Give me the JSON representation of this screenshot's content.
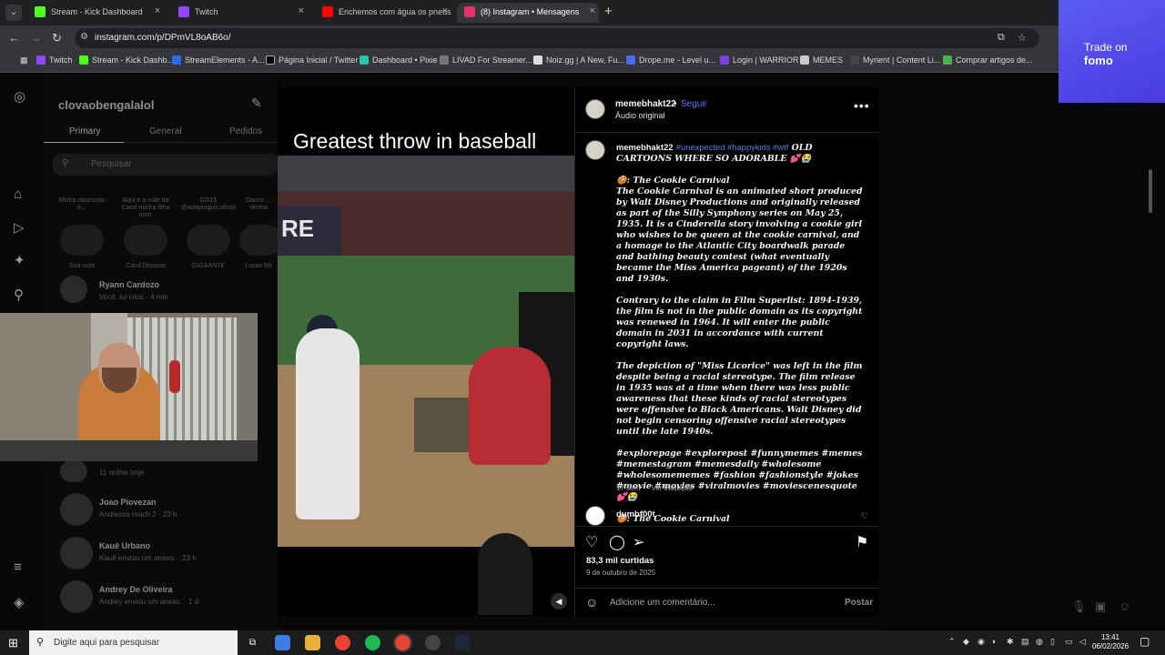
{
  "browser": {
    "tabs": [
      {
        "label": "Stream - Kick Dashboard",
        "color": "#53fc18"
      },
      {
        "label": "Twitch",
        "color": "#9146ff"
      },
      {
        "label": "Enchemos com água os pneus",
        "color": "#ff0000"
      },
      {
        "label": "(8) Instagram • Mensagens",
        "color": "#e1306c"
      }
    ],
    "url": "instagram.com/p/DPmVL8oAB6o/",
    "bookmarks": [
      "Twitch",
      "Stream - Kick Dashb...",
      "StreamElements - A...",
      "Página Inicial / Twitter",
      "Dashboard • Pixie",
      "LIVAD For Streamer...",
      "Noiz.gg | A New, Fu...",
      "Drope.me - Level u...",
      "Login | WARRIOR",
      "MEMES",
      "Myrient | Content Li...",
      "Comprar artigos de..."
    ]
  },
  "ad": {
    "line1": "Trade on",
    "line2": "fomo"
  },
  "dm": {
    "account": "clovaobengalalol",
    "tabs": [
      "Primary",
      "General",
      "Pedidos"
    ],
    "search_placeholder": "Pesquisar",
    "notes": [
      {
        "bubble": "Minha obsessão é...",
        "name": "Sua nota"
      },
      {
        "bubble": "Aqui é a mãe da Carol minha filha morr",
        "name": "Carol Dionisio"
      },
      {
        "bubble": "GG15 @adaptogno.oficial",
        "name": "GIGAANTE"
      },
      {
        "bubble": "Dance ... Venha",
        "name": "Lucas Mil"
      }
    ],
    "top_chat": {
      "name": "Ryann Cardozo",
      "msg": "Você: lul lolus · 4 min"
    },
    "group_status": "11 online hoje",
    "chats": [
      {
        "name": "Joao Piovezan",
        "msg": "Andressa reach 2 · 23 h"
      },
      {
        "name": "Kauê Urbano",
        "msg": "Kauê enviou um anexo. · 23 h"
      },
      {
        "name": "Andrey De Oliveira",
        "msg": "Andrey enviou um anexo. · 1 d"
      }
    ]
  },
  "video": {
    "title": "Greatest throw in baseball",
    "banner": "RE"
  },
  "post": {
    "username": "memebhakt22",
    "follow_label": "Seguir",
    "separator": "•",
    "audio": "Áudio original",
    "caption_tags": "#unexpected #happykids #wtf",
    "caption_heading": "OLD CARTOONS WHERE SO ADORABLE",
    "caption_heading_emoji": "💕😭",
    "para_title": "🍪: The Cookie Carnival",
    "para1": "The Cookie Carnival is an animated short produced by Walt Disney Productions and originally released as part of the Silly Symphony series on May 25, 1935. It is a Cinderella story involving a cookie girl who wishes to be queen at the cookie carnival, and a homage to the Atlantic City boardwalk parade and bathing beauty contest (what eventually became the Miss America pageant) of the 1920s and 1930s.",
    "para2": "Contrary to the claim in Film Superlist: 1894-1939, the film is not in the public domain as its copyright was renewed in 1964. It will enter the public domain in 2031 in accordance with current copyright laws.",
    "para3": "The depiction of \"Miss Licorice\" was left in the film despite being a racial stereotype. The film release in 1935 was at a time when there was less public awareness that these kinds of racial stereotypes were offensive to Black Americans. Walt Disney did not begin censoring offensive racial stereotypes until the late 1940s.",
    "hashtags": "#explorepage #explorepost #funnymemes #memes #memestagram #memesdaily #wholesome #wholesomememes #fashion #fashionstyle #jokes #movie #movies #viralmovies #moviescenesquote 💕😭",
    "para_end": "🍪: The Cookie Carnival",
    "age": "17 sem",
    "translate": "Ver tradução",
    "commenter": "dumbf00t",
    "likes": "83,3 mil curtidas",
    "date": "9 de outubro de 2025",
    "comment_placeholder": "Adicione um comentário...",
    "post_button": "Postar"
  },
  "taskbar": {
    "search": "Digite aqui para pesquisar",
    "time": "13:41",
    "date": "06/02/2026"
  }
}
